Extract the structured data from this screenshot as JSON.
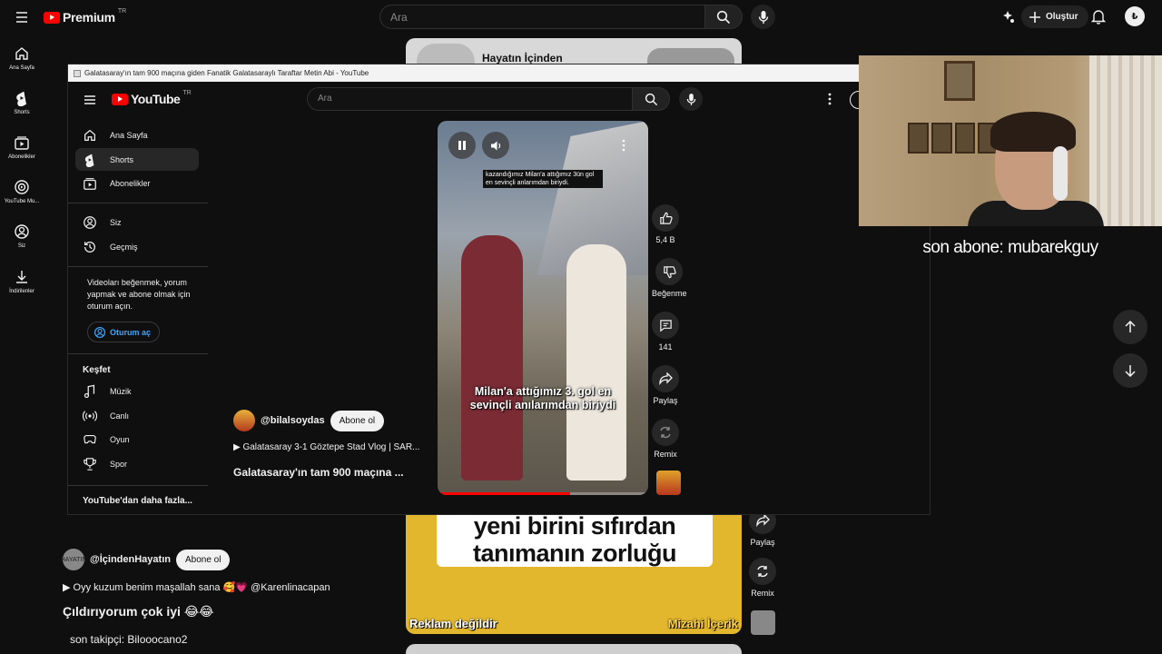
{
  "back": {
    "logo": "Premium",
    "logo_sup": "TR",
    "search_placeholder": "Ara",
    "create_label": "Oluştur",
    "avatar_text": "₺",
    "sidebar": [
      {
        "label": "Ana Sayfa",
        "icon": "home-icon"
      },
      {
        "label": "Shorts",
        "icon": "shorts-icon"
      },
      {
        "label": "Abonelikler",
        "icon": "subscriptions-icon"
      },
      {
        "label": "YouTube Mu...",
        "icon": "youtube-music-icon"
      },
      {
        "label": "Siz",
        "icon": "you-icon"
      },
      {
        "label": "İndirilenler",
        "icon": "download-icon"
      }
    ],
    "top_card_title": "Hayatın İçinden",
    "video2": {
      "caption_line1": "yeni birini sıfırdan",
      "caption_line2": "tanımanın zorluğu",
      "tag_left": "Reklam değildir",
      "tag_right": "Mizahi İçerik"
    },
    "actions": [
      {
        "label": "Paylaş",
        "icon": "share-icon"
      },
      {
        "label": "Remix",
        "icon": "remix-icon"
      }
    ],
    "channel": {
      "name": "@İçindenHayatın",
      "subscribe": "Abone ol",
      "avatar_text": "HAYATIN"
    },
    "link_text": "▶ Oyy kuzum benim maşallah sana 🥰💗 @Karenlinacapan",
    "title": "Çıldırıyorum çok iyi 😂😂",
    "follower_text": "son takipçi: Bilooocano2"
  },
  "front": {
    "window_title": "Galatasaray'ın tam 900 maçına giden Fanatik Galatasaraylı Taraftar Metin Abi - YouTube",
    "logo": "YouTube",
    "logo_sup": "TR",
    "search_placeholder": "Ara",
    "sidebar_main": [
      {
        "label": "Ana Sayfa",
        "icon": "home-icon",
        "active": false
      },
      {
        "label": "Shorts",
        "icon": "shorts-icon",
        "active": true
      },
      {
        "label": "Abonelikler",
        "icon": "subscriptions-icon",
        "active": false
      }
    ],
    "sidebar_you": [
      {
        "label": "Siz",
        "icon": "you-icon"
      },
      {
        "label": "Geçmiş",
        "icon": "history-icon"
      }
    ],
    "login_hint": "Videoları beğenmek, yorum yapmak ve abone olmak için oturum açın.",
    "login_button": "Oturum aç",
    "explore_heading": "Keşfet",
    "explore": [
      {
        "label": "Müzik",
        "icon": "music-icon"
      },
      {
        "label": "Canlı",
        "icon": "live-icon"
      },
      {
        "label": "Oyun",
        "icon": "gaming-icon"
      },
      {
        "label": "Spor",
        "icon": "sports-icon"
      }
    ],
    "more_link": "YouTube'dan daha fazla...",
    "short": {
      "top_subtitle": "kazandığımız Milan'a attığımız 3ün gol en sevinçli anlarımdan biriydi.",
      "caption_line1": "Milan'a attığımız 3. gol en",
      "caption_line2": "sevinçli anılarımdan biriydi",
      "progress": 0.63
    },
    "actions": [
      {
        "label": "5,4 B",
        "icon": "like-icon"
      },
      {
        "label": "Beğenme",
        "icon": "dislike-icon"
      },
      {
        "label": "141",
        "icon": "comment-icon"
      },
      {
        "label": "Paylaş",
        "icon": "share-icon"
      },
      {
        "label": "Remix",
        "icon": "remix-icon"
      }
    ],
    "channel": {
      "name": "@bilalsoydas",
      "subscribe": "Abone ol"
    },
    "link_text": "▶ Galatasaray 3-1 Göztepe Stad Vlog | SAR...",
    "title": "Galatasaray'ın tam 900 maçına ..."
  },
  "webcam_text": "son abone: mubarekguy",
  "colors": {
    "accent": "#ff0000",
    "link": "#3ea6ff",
    "bg": "#0f0f0f"
  }
}
